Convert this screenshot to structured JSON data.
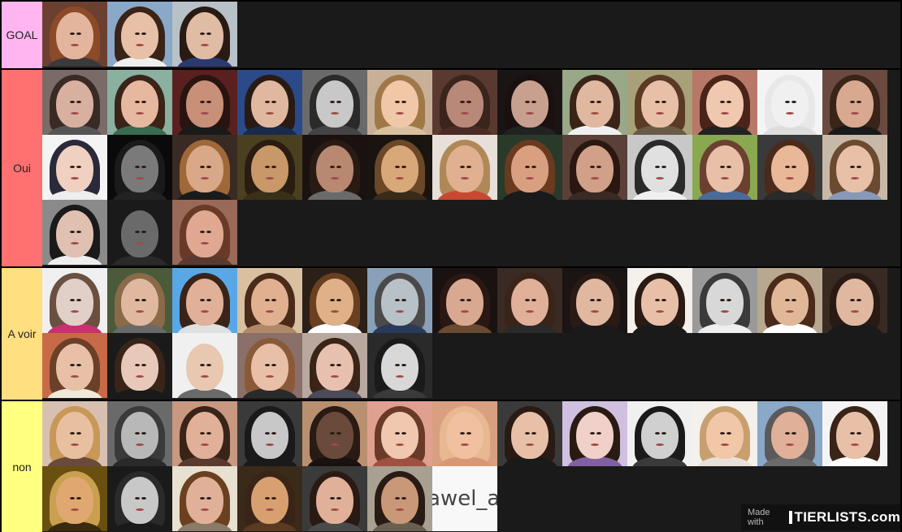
{
  "tiers": [
    {
      "label": "GOAL",
      "color": "#ffb6f0",
      "height": 82,
      "tiles": [
        {
          "bg": "#6b4030",
          "skin": "#e3b59c",
          "hair": "#8c4a28",
          "top": "#3a3a3a"
        },
        {
          "bg": "#8aa8c8",
          "skin": "#e8c0a8",
          "hair": "#3a2418",
          "top": "#eeeeee"
        },
        {
          "bg": "#b8c0c8",
          "skin": "#e0bca4",
          "hair": "#2a1a14",
          "top": "#2a3a70"
        }
      ]
    },
    {
      "label": "Oui",
      "color": "#ff7070",
      "height": 242,
      "tiles": [
        {
          "bg": "#7a6a68",
          "skin": "#d8b0a0",
          "hair": "#3a2a24",
          "top": "#555"
        },
        {
          "bg": "#8ab0a0",
          "skin": "#e6b8a0",
          "hair": "#3a2418",
          "top": "#3a6a50"
        },
        {
          "bg": "#5a2020",
          "skin": "#c89078",
          "hair": "#2a1410",
          "top": "#1a1a1a"
        },
        {
          "bg": "#2a4a8a",
          "skin": "#e0b8a0",
          "hair": "#2a1a14",
          "top": "#1a2a4a"
        },
        {
          "bg": "#6a6a6a",
          "skin": "#c8c8c8",
          "hair": "#2a2a2a",
          "top": "#444"
        },
        {
          "bg": "#c8b098",
          "skin": "#f0c8a8",
          "hair": "#a07848",
          "top": "#d8c0a0"
        },
        {
          "bg": "#5a3a30",
          "skin": "#b88878",
          "hair": "#3a241c",
          "top": "#4a2a24"
        },
        {
          "bg": "#1a1414",
          "skin": "#c8a090",
          "hair": "#1a1010",
          "top": "#222"
        },
        {
          "bg": "#98a888",
          "skin": "#e0b8a0",
          "hair": "#3a2418",
          "top": "#f0f0f0"
        },
        {
          "bg": "#a8a078",
          "skin": "#e8c0a8",
          "hair": "#5a3a24",
          "top": "#6a5a48"
        },
        {
          "bg": "#b87868",
          "skin": "#f0c8b0",
          "hair": "#4a2418",
          "top": "#222"
        },
        {
          "bg": "#f4f4f4",
          "skin": "#f0f0f0",
          "hair": "#e8e8e8",
          "top": "#dddddd"
        },
        {
          "bg": "#6a4a40",
          "skin": "#d8a890",
          "hair": "#3a2418",
          "top": "#1a1a1a"
        },
        {
          "bg": "#f4f4f4",
          "skin": "#f0d0c0",
          "hair": "#2a2a3a",
          "top": "#eeeeee"
        },
        {
          "bg": "#0a0a0a",
          "skin": "#7a7a7a",
          "hair": "#1a1a1a",
          "top": "#222"
        },
        {
          "bg": "#3a2a24",
          "skin": "#d8a888",
          "hair": "#a06838",
          "top": "#1a1a1a"
        },
        {
          "bg": "#4a4020",
          "skin": "#c89868",
          "hair": "#2a1c10",
          "top": "#3a3018"
        },
        {
          "bg": "#1a1210",
          "skin": "#b88870",
          "hair": "#2a1a14",
          "top": "#6a6a6a"
        },
        {
          "bg": "#1a1410",
          "skin": "#d8a878",
          "hair": "#6a4828",
          "top": "#3a2a1a"
        },
        {
          "bg": "#e8e0d8",
          "skin": "#e0b090",
          "hair": "#b08858",
          "top": "#c84830"
        },
        {
          "bg": "#2a3a2a",
          "skin": "#d8a080",
          "hair": "#6a3a20",
          "top": "#1a1a1a"
        },
        {
          "bg": "#5a4038",
          "skin": "#d0a088",
          "hair": "#2a1810",
          "top": "#3a2a24"
        },
        {
          "bg": "#c8c8c8",
          "skin": "#e0e0e0",
          "hair": "#2a2a2a",
          "top": "#f0f0f0"
        },
        {
          "bg": "#8aa850",
          "skin": "#e8c0a8",
          "hair": "#6a4030",
          "top": "#4a6a9a"
        },
        {
          "bg": "#3a3a3a",
          "skin": "#e8b898",
          "hair": "#4a2a1a",
          "top": "#2a2a2a"
        },
        {
          "bg": "#c8b8a8",
          "skin": "#e8c0a8",
          "hair": "#6a4a30",
          "top": "#8898b8"
        },
        {
          "bg": "#8a8a8a",
          "skin": "#e0c0b0",
          "hair": "#1a1a1a",
          "top": "#eeeeee"
        },
        {
          "bg": "#1a1a1a",
          "skin": "#6a6a6a",
          "hair": "#1a1a1a",
          "top": "#2a2a2a"
        },
        {
          "bg": "#9a6a58",
          "skin": "#e0a890",
          "hair": "#6a3a28",
          "top": "#5a3a30"
        }
      ]
    },
    {
      "label": "A voir",
      "color": "#ffdf80",
      "height": 162,
      "tiles": [
        {
          "bg": "#f0f0f0",
          "skin": "#e0d0c8",
          "hair": "#6a5040",
          "top": "#c83070",
          "text": ""
        },
        {
          "bg": "#4a5a3a",
          "skin": "#e0b8a0",
          "hair": "#8a6a48",
          "top": "#6a6a6a"
        },
        {
          "bg": "#58a8e8",
          "skin": "#e0b098",
          "hair": "#3a2418",
          "top": "#e0e0e0"
        },
        {
          "bg": "#d8c0a0",
          "skin": "#e0b090",
          "hair": "#4a2a18",
          "top": "#b08868"
        },
        {
          "bg": "#2a2018",
          "skin": "#e0b088",
          "hair": "#6a4020",
          "top": "#ffffff"
        },
        {
          "bg": "#8aa0b8",
          "skin": "#b8c0c8",
          "hair": "#4a4a4a",
          "top": "#2a3a5a"
        },
        {
          "bg": "#1a1210",
          "skin": "#d8a890",
          "hair": "#2a1814",
          "top": "#6a4a30"
        },
        {
          "bg": "#3a2a24",
          "skin": "#e0b098",
          "hair": "#3a2418",
          "top": "#2a2a2a"
        },
        {
          "bg": "#1a1414",
          "skin": "#e0b8a0",
          "hair": "#2a1a14",
          "top": "#1a1a1a"
        },
        {
          "bg": "#f4f0ec",
          "skin": "#e8c0a8",
          "hair": "#2a1a14",
          "top": "#1a1a1a"
        },
        {
          "bg": "#9a9a9a",
          "skin": "#d8d8d8",
          "hair": "#3a3a3a",
          "top": "#eeeeee"
        },
        {
          "bg": "#b8a890",
          "skin": "#e0b898",
          "hair": "#4a2a1a",
          "top": "#ffffff"
        },
        {
          "bg": "#3a2a24",
          "skin": "#e0b8a0",
          "hair": "#2a1a14",
          "top": "#1a1a1a"
        },
        {
          "bg": "#c86a48",
          "skin": "#e8c0a8",
          "hair": "#6a4028",
          "top": "#f0e8d8"
        },
        {
          "bg": "#1a1a1a",
          "skin": "#e8c8b8",
          "hair": "#3a2418",
          "top": "#1a1a1a"
        },
        {
          "bg": "#f0f0f0",
          "skin": "#e8c8b0",
          "hair": "#f0f0f0",
          "top": "#6a6a6a"
        },
        {
          "bg": "#8a7068",
          "skin": "#e8c0a8",
          "hair": "#8a5a38",
          "top": "#2a2a2a"
        },
        {
          "bg": "#b8a8a0",
          "skin": "#e8c0b0",
          "hair": "#3a2418",
          "top": "#4a4a5a"
        },
        {
          "bg": "#2a2a2a",
          "skin": "#d8d8d8",
          "hair": "#1a1a1a",
          "top": "#3a3a3a"
        }
      ]
    },
    {
      "label": "non",
      "color": "#ffff80",
      "height": 162,
      "tiles": [
        {
          "bg": "#d8c0b0",
          "skin": "#e8c0a0",
          "hair": "#c89858",
          "top": "#6a4a3a"
        },
        {
          "bg": "#6a6a6a",
          "skin": "#b8b8b8",
          "hair": "#3a3a3a",
          "top": "#2a2a2a"
        },
        {
          "bg": "#c89880",
          "skin": "#e0b098",
          "hair": "#3a2418",
          "top": "#5a3a30"
        },
        {
          "bg": "#3a3a3a",
          "skin": "#c8c8c8",
          "hair": "#1a1a1a",
          "top": "#1a1a1a"
        },
        {
          "bg": "#b89070",
          "skin": "#6a4a3a",
          "hair": "#2a1a14",
          "top": "#1a1210"
        },
        {
          "bg": "#e0a090",
          "skin": "#f0c8b0",
          "hair": "#6a3a28",
          "top": "#a05040"
        },
        {
          "bg": "#d8a080",
          "skin": "#f0c0a0",
          "hair": "#e8b890",
          "top": "#d89878"
        },
        {
          "bg": "#3a3a3a",
          "skin": "#e8c0a8",
          "hair": "#2a1a14",
          "top": "#1a1a1a"
        },
        {
          "bg": "#d0c0e0",
          "skin": "#f0d0c8",
          "hair": "#2a1a14",
          "top": "#8060a0"
        },
        {
          "bg": "#f0f0f0",
          "skin": "#d0d0d0",
          "hair": "#1a1a1a",
          "top": "#3a3a3a"
        },
        {
          "bg": "#f4f0ec",
          "skin": "#f0c8a8",
          "hair": "#c8a070",
          "top": "#e8e0d8"
        },
        {
          "bg": "#8aa8c8",
          "skin": "#e0b098",
          "hair": "#5a5a5a",
          "top": "#6a6a6a"
        },
        {
          "bg": "#f4f4f4",
          "skin": "#e8c0a8",
          "hair": "#3a2418",
          "top": "#ffffff"
        },
        {
          "bg": "#6a5010",
          "skin": "#e0a870",
          "hair": "#c8a050",
          "top": "#3a2a10"
        },
        {
          "bg": "#1a1a1a",
          "skin": "#c8c8c8",
          "hair": "#2a2a2a",
          "top": "#1a1a1a"
        },
        {
          "bg": "#e8e0d0",
          "skin": "#e0b098",
          "hair": "#6a4020",
          "top": "#8a7a68"
        },
        {
          "bg": "#3a2a1a",
          "skin": "#d8a070",
          "hair": "#3a2418",
          "top": "#5a3a20"
        },
        {
          "bg": "#3a3a3a",
          "skin": "#e0b098",
          "hair": "#2a1a14",
          "top": "#4a4a4a"
        },
        {
          "bg": "#a8a090",
          "skin": "#c89878",
          "hair": "#2a1a14",
          "top": "#6a6050"
        },
        {
          "bg": "#f8f8f8",
          "skin": "#f8f8f8",
          "hair": "#f8f8f8",
          "top": "#f8f8f8",
          "text": "awel_a"
        }
      ]
    }
  ],
  "watermark": {
    "made_with": "Made with",
    "brand": "TIERLISTS.com"
  }
}
